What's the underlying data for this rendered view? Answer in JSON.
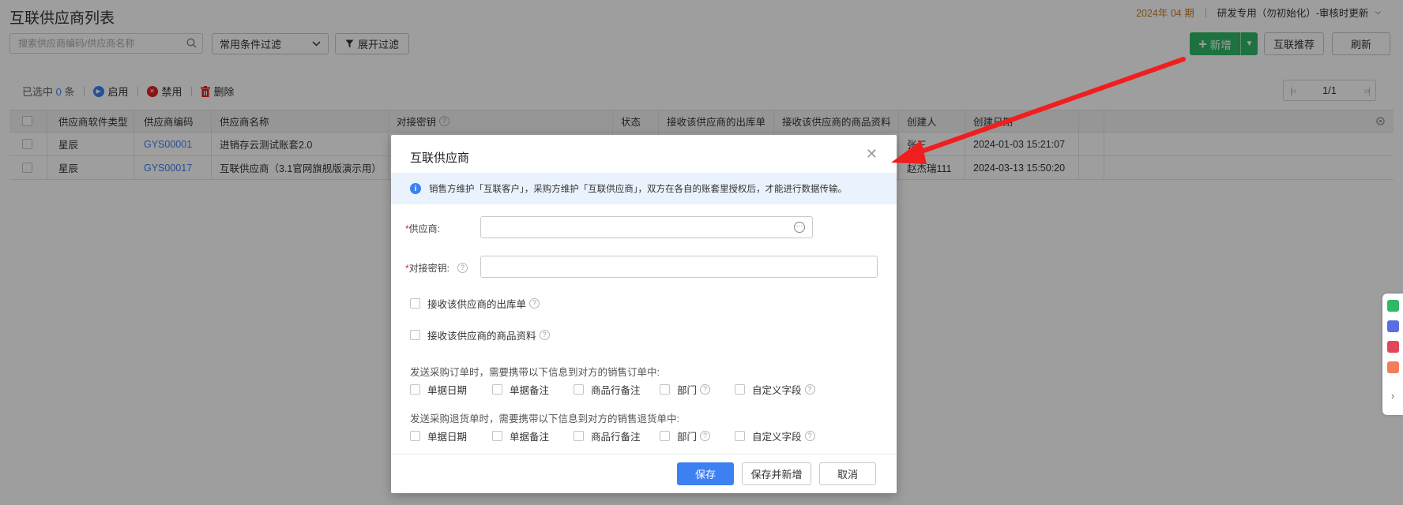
{
  "page": {
    "title": "互联供应商列表",
    "period": "2024年 04 期",
    "account": "研发专用（勿初始化）-审核时更新"
  },
  "search": {
    "placeholder": "搜索供应商编码/供应商名称"
  },
  "filter": {
    "selected": "常用条件过滤",
    "expand_label": "展开过滤"
  },
  "actions": {
    "add_label": "新增",
    "hl_recommend_label": "互联推荐",
    "refresh_label": "刷新"
  },
  "toolbar": {
    "selected_prefix": "已选中",
    "selected_count": "0",
    "selected_suffix": "条",
    "enable_label": "启用",
    "disable_label": "禁用",
    "delete_label": "删除"
  },
  "pager": {
    "text": "1/1"
  },
  "table": {
    "headers": [
      "供应商软件类型",
      "供应商编码",
      "供应商名称",
      "对接密钥",
      "状态",
      "接收该供应商的出库单",
      "接收该供应商的商品资料",
      "创建人",
      "创建日期"
    ],
    "rows": [
      {
        "type": "星辰",
        "code": "GYS00001",
        "name": "进销存云测试账套2.0",
        "key": "",
        "status": "",
        "recv_out": "",
        "recv_goods": "",
        "creator": "张三",
        "date": "2024-01-03 15:21:07"
      },
      {
        "type": "星辰",
        "code": "GYS00017",
        "name": "互联供应商（3.1官网旗舰版演示用）",
        "key": "",
        "status": "",
        "recv_out": "",
        "recv_goods": "",
        "creator": "赵杰瑞111",
        "date": "2024-03-13 15:50:20"
      }
    ]
  },
  "dialog": {
    "title": "互联供应商",
    "info": "销售方维护「互联客户」，采购方维护「互联供应商」，双方在各自的账套里授权后，才能进行数据传输。",
    "supplier_label": "供应商:",
    "key_label": "对接密钥:",
    "supplier_value": "",
    "key_value": "",
    "recv_out_label": "接收该供应商的出库单",
    "recv_goods_label": "接收该供应商的商品资料",
    "po_section": "发送采购订单时，需要携带以下信息到对方的销售订单中:",
    "pr_section": "发送采购退货单时，需要携带以下信息到对方的销售退货单中:",
    "options": [
      "单据日期",
      "单据备注",
      "商品行备注",
      "部门",
      "自定义字段"
    ],
    "save_label": "保存",
    "save_new_label": "保存并新增",
    "cancel_label": "取消"
  },
  "colors": {
    "primary": "#3d80f2",
    "success": "#2fb866",
    "danger": "#e02020",
    "arrow": "#f01f1f",
    "period": "#c87d33"
  }
}
